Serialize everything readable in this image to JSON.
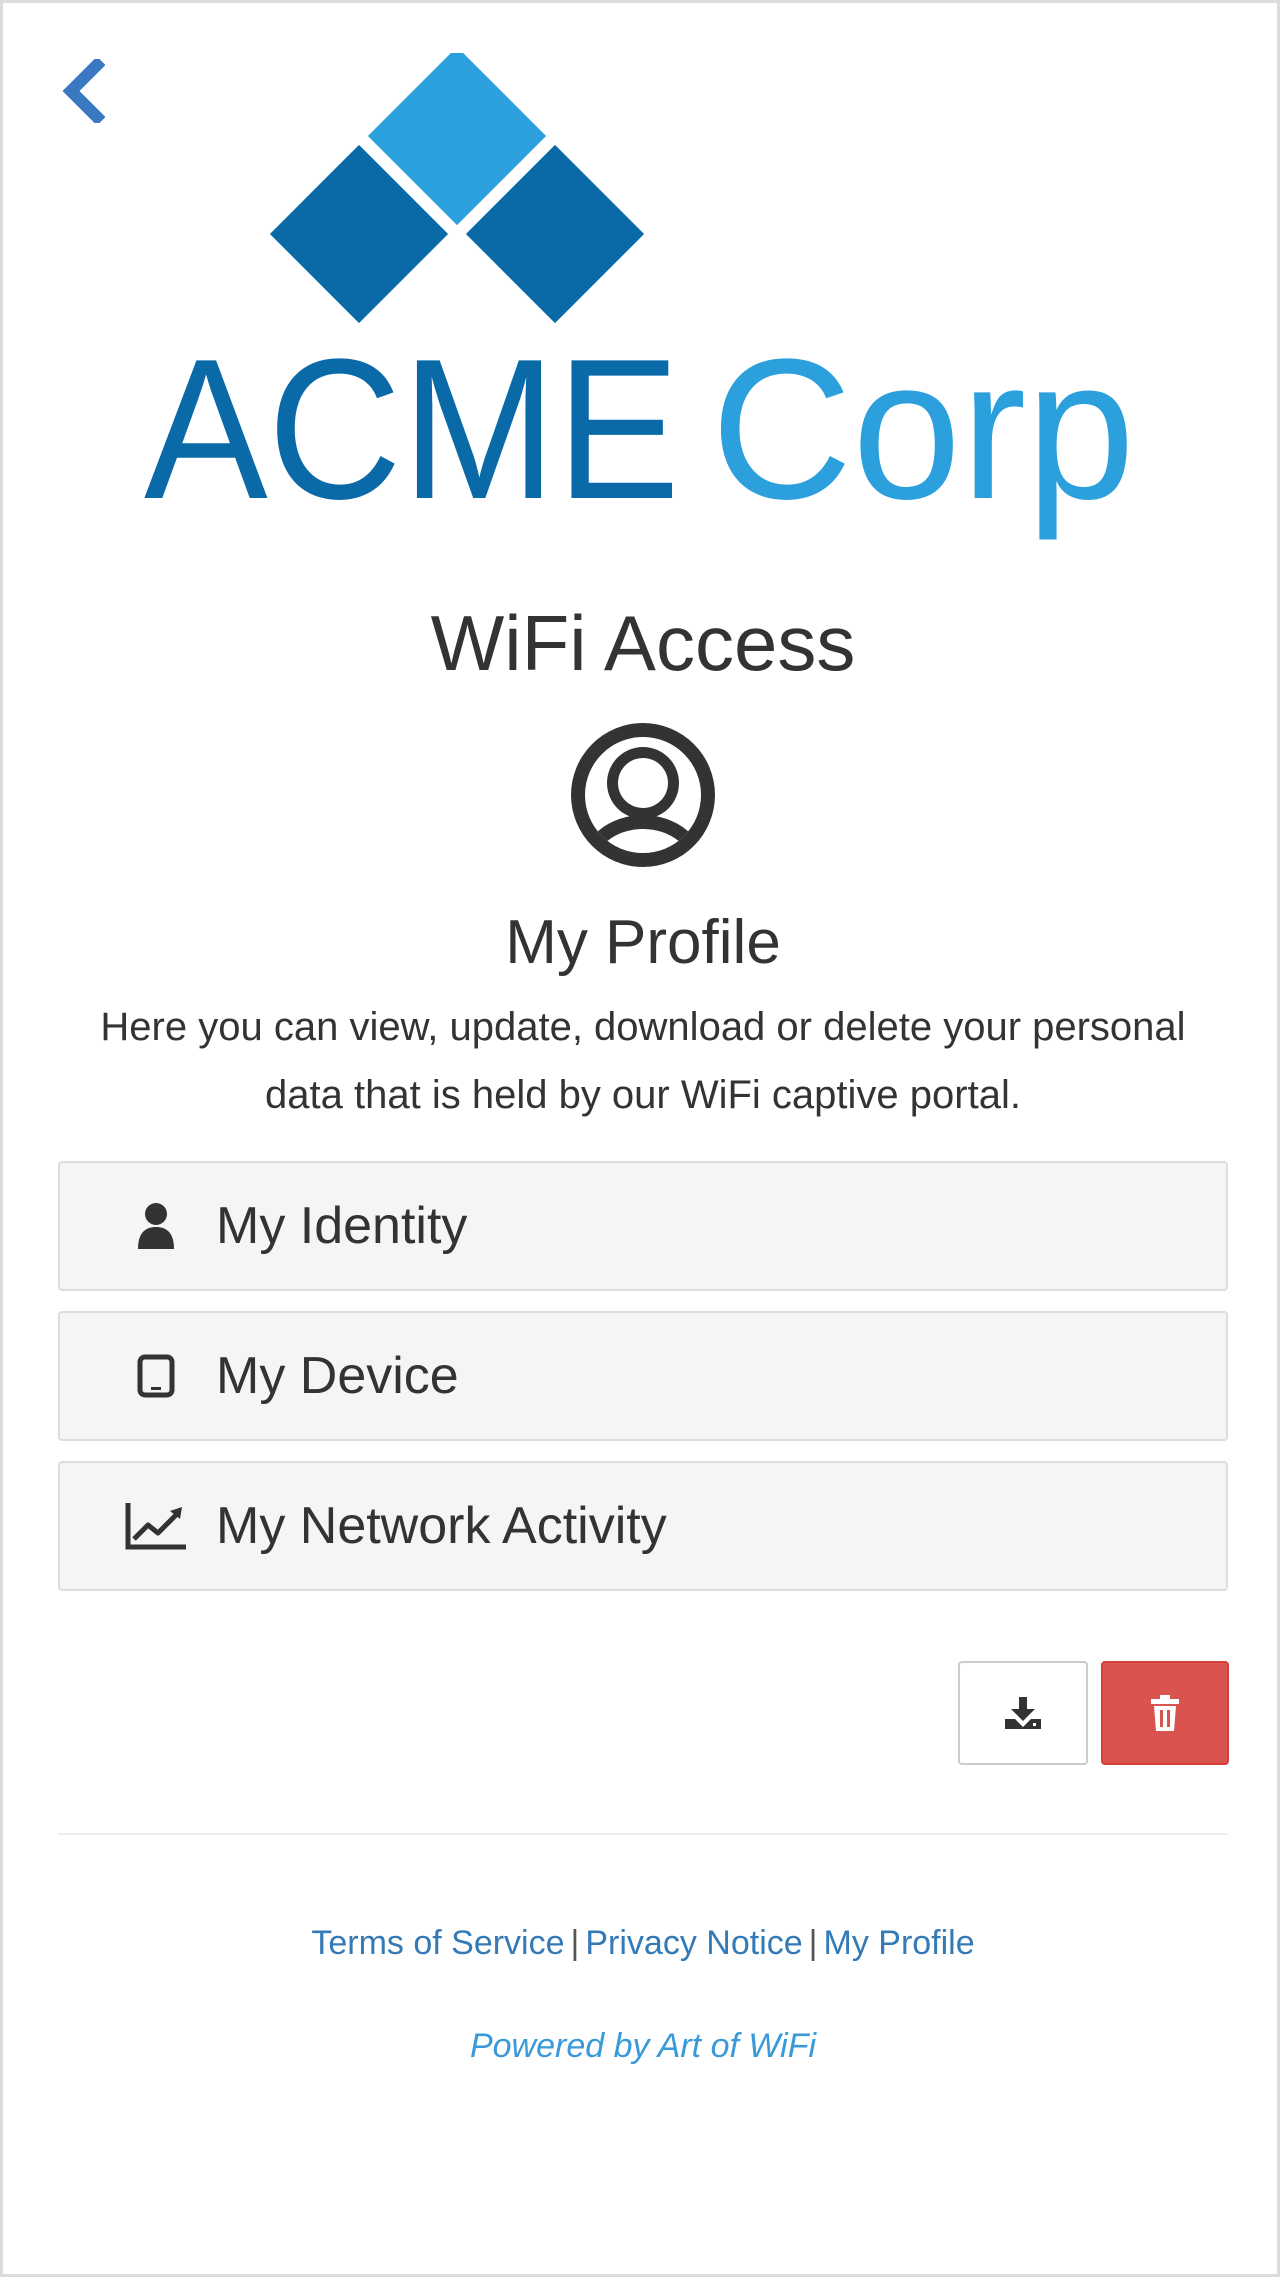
{
  "header": {
    "back_icon": "chevron-left-icon",
    "logo": {
      "word1": "ACME",
      "word2": "Corp",
      "color_dark": "#0a6aa8",
      "color_light": "#2ba0dc"
    }
  },
  "main": {
    "title": "WiFi Access",
    "avatar_icon": "user-circle-icon",
    "section_title": "My Profile",
    "description": "Here you can view, update, download or delete your personal data that is held by our WiFi captive portal.",
    "panels": [
      {
        "label": "My Identity",
        "icon": "user-icon"
      },
      {
        "label": "My Device",
        "icon": "tablet-icon"
      },
      {
        "label": "My Network Activity",
        "icon": "line-chart-icon"
      }
    ],
    "actions": {
      "download_icon": "download-icon",
      "delete_icon": "trash-icon",
      "delete_color": "#d9534f"
    }
  },
  "footer": {
    "links": [
      {
        "label": "Terms of Service"
      },
      {
        "label": "Privacy Notice"
      },
      {
        "label": "My Profile"
      }
    ],
    "separator": "|",
    "powered_by": "Powered by Art of WiFi",
    "link_color": "#337ab7"
  }
}
